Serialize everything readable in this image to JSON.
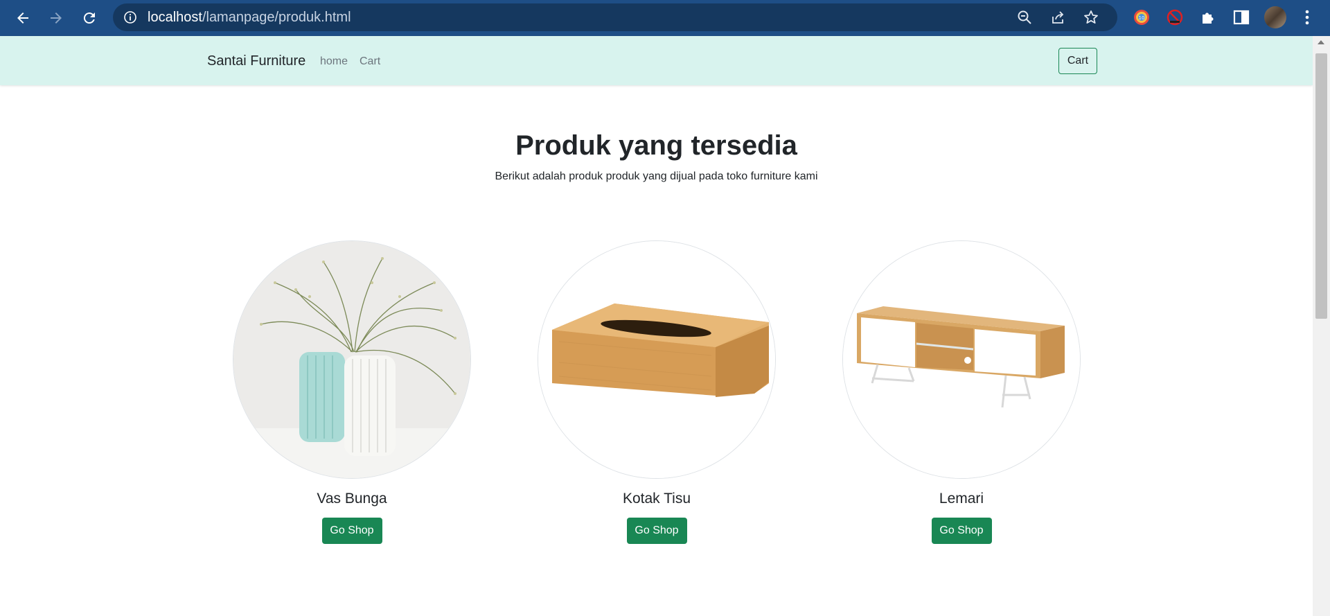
{
  "browser": {
    "url_host": "localhost",
    "url_path": "/lamanpage/produk.html"
  },
  "navbar": {
    "brand": "Santai Furniture",
    "links": [
      "home",
      "Cart"
    ],
    "cart_button": "Cart"
  },
  "main": {
    "title": "Produk yang tersedia",
    "subtitle": "Berikut adalah produk produk yang dijual pada toko furniture kami"
  },
  "products": [
    {
      "name": "Vas Bunga",
      "button": "Go Shop"
    },
    {
      "name": "Kotak Tisu",
      "button": "Go Shop"
    },
    {
      "name": "Lemari",
      "button": "Go Shop"
    }
  ],
  "colors": {
    "chrome": "#1e4e86",
    "navbar_bg": "#d8f3ee",
    "button_green": "#198754"
  }
}
